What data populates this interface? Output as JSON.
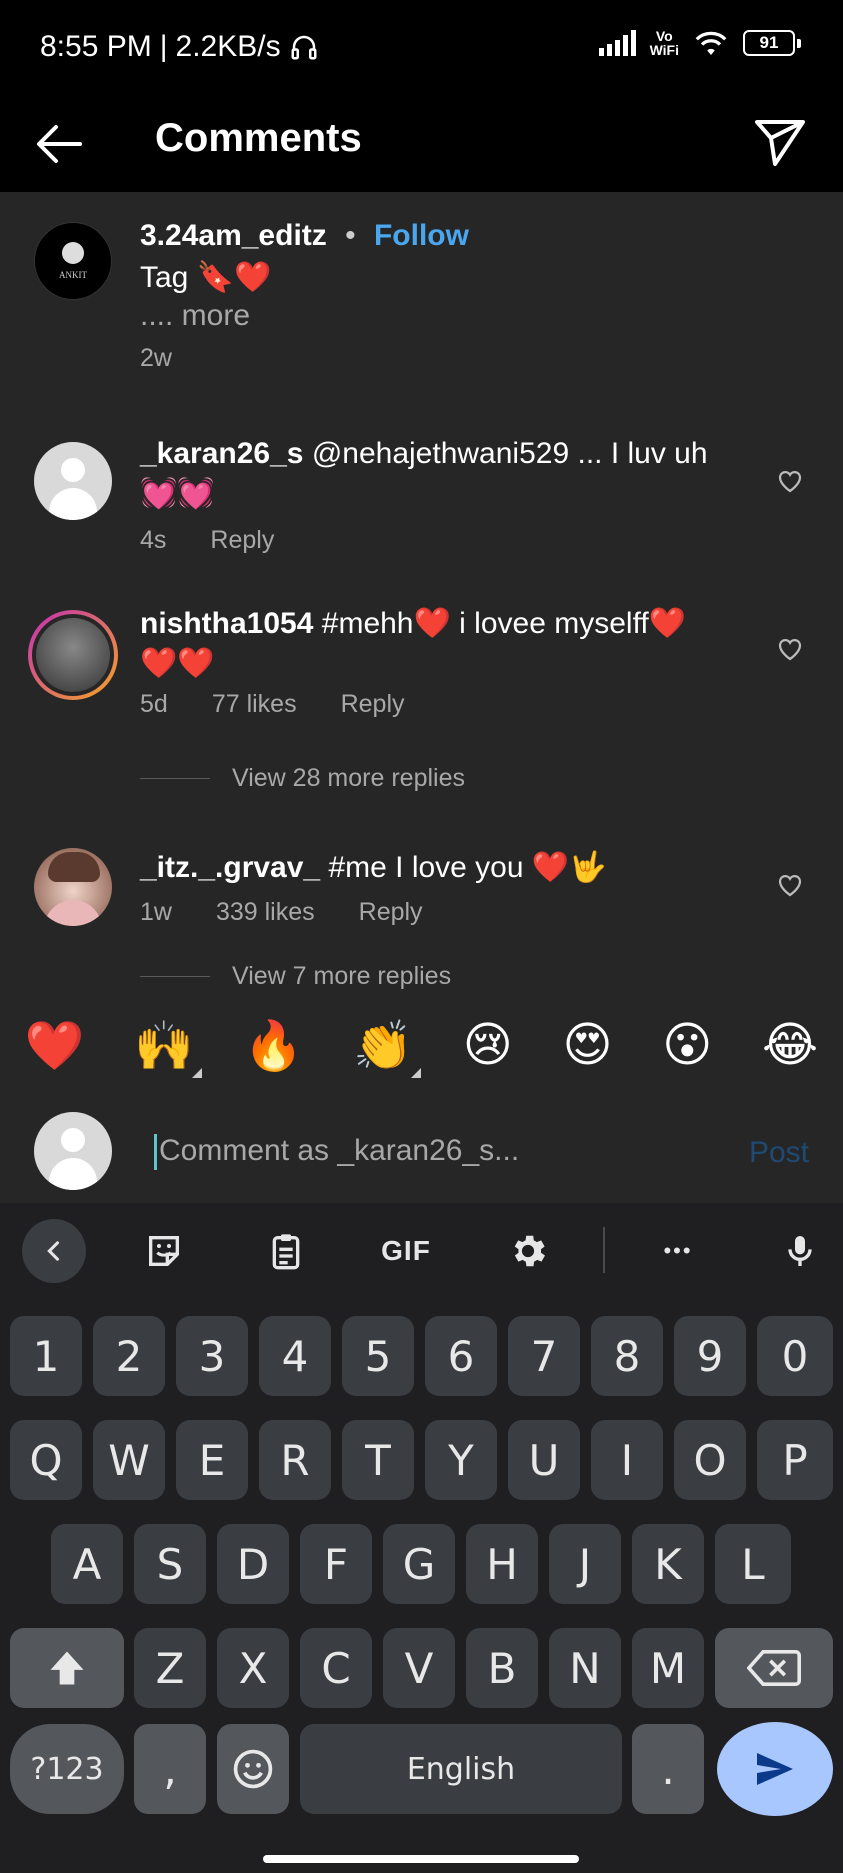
{
  "status": {
    "time": "8:55 PM",
    "speed": "2.2KB/s",
    "vo": "Vo",
    "wifi_label": "WiFi",
    "battery": "91"
  },
  "header": {
    "title": "Comments"
  },
  "caption": {
    "username": "3.24am_editz",
    "dot": "•",
    "follow": "Follow",
    "text": "Tag 🔖❤️",
    "more": ".... more",
    "time": "2w",
    "avatar_text": "ANKIT"
  },
  "comments": [
    {
      "username": "_karan26_s",
      "text": "@nehajethwani529 ... I luv uh 💓💓",
      "time": "4s",
      "likes": "",
      "reply": "Reply"
    },
    {
      "username": "nishtha1054",
      "text": "#mehh❤️ i lovee myselff❤️❤️❤️",
      "time": "5d",
      "likes": "77 likes",
      "reply": "Reply",
      "view_more": "View 28 more replies"
    },
    {
      "username": "_itz._.grvav_",
      "text": "#me I love you ❤️🤟",
      "time": "1w",
      "likes": "339 likes",
      "reply": "Reply",
      "view_more": "View 7 more replies"
    }
  ],
  "reactions": [
    "❤️",
    "🙌",
    "🔥",
    "👏",
    "😢",
    "😍",
    "😮",
    "😂"
  ],
  "composer": {
    "placeholder": "Comment as _karan26_s...",
    "post": "Post"
  },
  "keyboard": {
    "toolbar": {
      "gif": "GIF",
      "more": "•••"
    },
    "row_numbers": [
      "1",
      "2",
      "3",
      "4",
      "5",
      "6",
      "7",
      "8",
      "9",
      "0"
    ],
    "row1": [
      "Q",
      "W",
      "E",
      "R",
      "T",
      "Y",
      "U",
      "I",
      "O",
      "P"
    ],
    "row2": [
      "A",
      "S",
      "D",
      "F",
      "G",
      "H",
      "J",
      "K",
      "L"
    ],
    "row3": [
      "Z",
      "X",
      "C",
      "V",
      "B",
      "N",
      "M"
    ],
    "bottom": {
      "symbols": "?123",
      "comma": ",",
      "space": "English",
      "period": "."
    }
  }
}
